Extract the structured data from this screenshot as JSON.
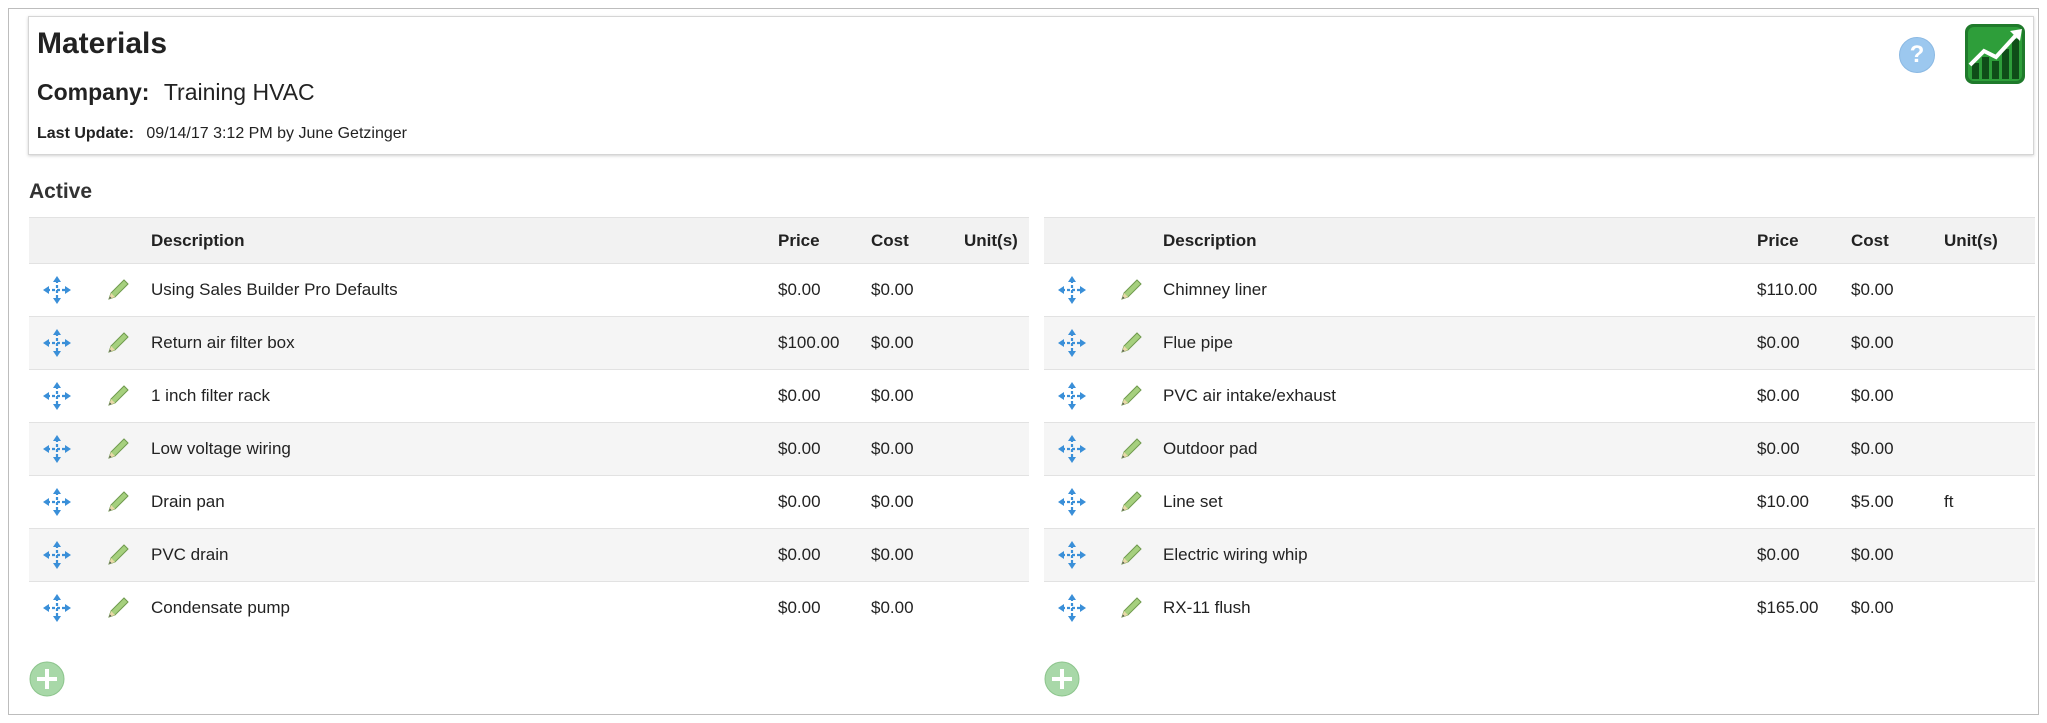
{
  "header": {
    "title": "Materials",
    "company_label": "Company:",
    "company_value": "Training HVAC",
    "last_update_label": "Last Update:",
    "last_update_value": "09/14/17 3:12 PM by June Getzinger",
    "help_glyph": "?"
  },
  "section_title": "Active",
  "columns": {
    "description": "Description",
    "price": "Price",
    "cost": "Cost",
    "units": "Unit(s)"
  },
  "left_table": {
    "rows": [
      {
        "description": "Using Sales Builder Pro Defaults",
        "price": "$0.00",
        "cost": "$0.00",
        "units": ""
      },
      {
        "description": "Return air filter box",
        "price": "$100.00",
        "cost": "$0.00",
        "units": ""
      },
      {
        "description": "1 inch filter rack",
        "price": "$0.00",
        "cost": "$0.00",
        "units": ""
      },
      {
        "description": "Low voltage wiring",
        "price": "$0.00",
        "cost": "$0.00",
        "units": ""
      },
      {
        "description": "Drain pan",
        "price": "$0.00",
        "cost": "$0.00",
        "units": ""
      },
      {
        "description": "PVC drain",
        "price": "$0.00",
        "cost": "$0.00",
        "units": ""
      },
      {
        "description": "Condensate pump",
        "price": "$0.00",
        "cost": "$0.00",
        "units": ""
      }
    ]
  },
  "right_table": {
    "rows": [
      {
        "description": "Chimney liner",
        "price": "$110.00",
        "cost": "$0.00",
        "units": ""
      },
      {
        "description": "Flue pipe",
        "price": "$0.00",
        "cost": "$0.00",
        "units": ""
      },
      {
        "description": "PVC air intake/exhaust",
        "price": "$0.00",
        "cost": "$0.00",
        "units": ""
      },
      {
        "description": "Outdoor pad",
        "price": "$0.00",
        "cost": "$0.00",
        "units": ""
      },
      {
        "description": "Line set",
        "price": "$10.00",
        "cost": "$5.00",
        "units": "ft"
      },
      {
        "description": "Electric wiring whip",
        "price": "$0.00",
        "cost": "$0.00",
        "units": ""
      },
      {
        "description": "RX-11 flush",
        "price": "$165.00",
        "cost": "$0.00",
        "units": ""
      }
    ]
  },
  "icons": {
    "move": "move-arrows-icon",
    "edit": "pencil-icon",
    "add": "plus-circle-icon",
    "help": "help-icon",
    "app": "growth-chart-icon"
  },
  "colors": {
    "move_icon": "#3a8fd8",
    "pencil_icon": "#8fbf6a",
    "add_button": "#a8d8a8",
    "help_button": "#9cc8ef",
    "app_icon": "#2e9e3a"
  }
}
